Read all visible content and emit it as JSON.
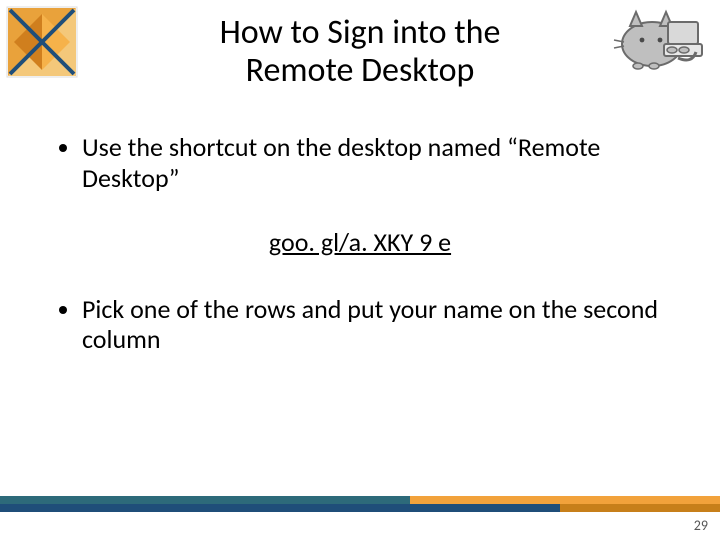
{
  "title_line1": "How to Sign into the",
  "title_line2": "Remote Desktop",
  "bullets": [
    "Use the shortcut on the desktop named “Remote Desktop”",
    "Pick one of the rows and put your name on the second column"
  ],
  "link_text": "goo. gl/a. XKY 9 e",
  "page_number": "29",
  "colors": {
    "bar_teal": "#2d6a7a",
    "bar_blue": "#1f4e79",
    "bar_orange": "#f2a23b",
    "bar_orange_dark": "#c77f1a"
  },
  "icons": {
    "org_logo": "hourglass-logo-icon",
    "cat_laptop": "cat-laptop-icon"
  }
}
